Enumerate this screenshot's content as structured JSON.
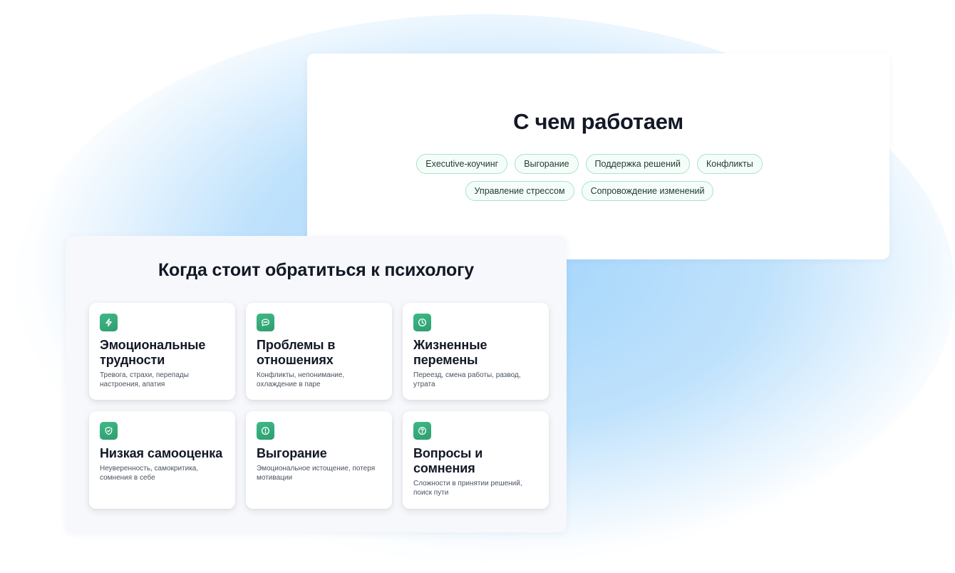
{
  "work": {
    "title": "С чем работаем",
    "tags": [
      "Executive-коучинг",
      "Выгорание",
      "Поддержка решений",
      "Конфликты",
      "Управление стрессом",
      "Сопровождение изменений"
    ]
  },
  "when": {
    "title": "Когда стоит обратиться к психологу",
    "items": [
      {
        "icon": "lightning-icon",
        "title": "Эмоциональные трудности",
        "text": "Тревога, страхи, перепады настроения, апатия"
      },
      {
        "icon": "chat-bubble-icon",
        "title": "Проблемы в отношениях",
        "text": "Конфликты, непонимание, охлаждение в паре"
      },
      {
        "icon": "clock-icon",
        "title": "Жизненные перемены",
        "text": "Переезд, смена работы, развод, утрата"
      },
      {
        "icon": "shield-check-icon",
        "title": "Низкая самооценка",
        "text": "Неуверенность, самокритика, сомнения в себе"
      },
      {
        "icon": "alert-circle-icon",
        "title": "Выгорание",
        "text": "Эмоциональное истощение, потеря мотивации"
      },
      {
        "icon": "question-circle-icon",
        "title": "Вопросы и сомнения",
        "text": "Сложности в принятии решений, поиск пути"
      }
    ]
  },
  "colors": {
    "accent_green": "#34a97a",
    "tag_border": "#a7e3cc",
    "glow_blue": "#93cefa",
    "heading": "#121826"
  }
}
